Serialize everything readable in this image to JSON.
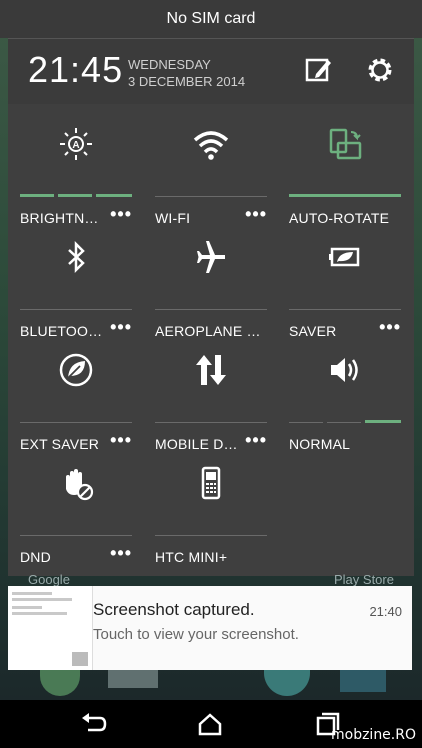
{
  "status_bar": {
    "carrier": "No SIM card"
  },
  "header": {
    "time": "21:45",
    "day": "WEDNESDAY",
    "date": "3 DECEMBER 2014",
    "edit_icon": "edit-icon",
    "settings_icon": "gear-icon"
  },
  "tiles": [
    {
      "label": "BRIGHTNE…",
      "icon": "brightness-auto-icon",
      "more": "•••",
      "level_segments": 3,
      "active_segments": 3
    },
    {
      "label": "WI-FI",
      "icon": "wifi-icon",
      "more": "•••"
    },
    {
      "label": "AUTO-ROTATE",
      "icon": "auto-rotate-icon",
      "active": true
    },
    {
      "label": "BLUETOOTH",
      "icon": "bluetooth-icon",
      "more": "•••"
    },
    {
      "label": "AEROPLANE MO…",
      "icon": "airplane-icon"
    },
    {
      "label": "SAVER",
      "icon": "battery-saver-icon",
      "more": "•••"
    },
    {
      "label": "EXT SAVER",
      "icon": "extreme-saver-icon",
      "more": "•••"
    },
    {
      "label": "MOBILE DA…",
      "icon": "mobile-data-icon",
      "more": "•••"
    },
    {
      "label": "NORMAL",
      "icon": "volume-icon",
      "level_segments": 3,
      "active_segments": 1
    },
    {
      "label": "DND",
      "icon": "do-not-disturb-icon",
      "more": "•••"
    },
    {
      "label": "HTC MINI+",
      "icon": "htc-mini-icon"
    }
  ],
  "background_labels": {
    "left": "Google",
    "right": "Play Store"
  },
  "notification": {
    "title": "Screenshot captured.",
    "subtitle": "Touch to view your screenshot.",
    "time": "21:40"
  },
  "nav": {
    "back_icon": "back-icon",
    "home_icon": "home-icon",
    "recents_icon": "recents-icon"
  },
  "watermark": "mobzine.RO",
  "colors": {
    "accent": "#6db07f",
    "panel": "#3f3f3f",
    "header": "#3b3b3b"
  }
}
